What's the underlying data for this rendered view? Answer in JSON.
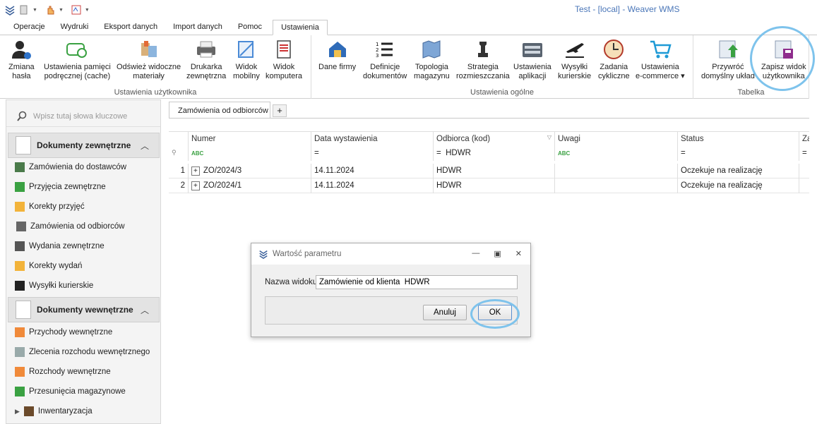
{
  "window": {
    "title": "Test - [local] - Weaver WMS"
  },
  "tabs": [
    "Operacje",
    "Wydruki",
    "Eksport danych",
    "Import danych",
    "Pomoc",
    "Ustawienia"
  ],
  "ribbon": {
    "groups": [
      {
        "label": "Ustawienia użytkownika",
        "buttons": [
          {
            "l1": "Zmiana",
            "l2": "hasła",
            "icon": "user-password-icon"
          },
          {
            "l1": "Ustawienia pamięci",
            "l2": "podręcznej (cache)",
            "icon": "cache-settings-icon"
          },
          {
            "l1": "Odśwież widoczne",
            "l2": "materiały",
            "icon": "refresh-materials-icon"
          },
          {
            "l1": "Drukarka",
            "l2": "zewnętrzna",
            "icon": "printer-icon"
          },
          {
            "l1": "Widok",
            "l2": "mobilny",
            "icon": "mobile-view-icon"
          },
          {
            "l1": "Widok",
            "l2": "komputera",
            "icon": "computer-view-icon"
          }
        ]
      },
      {
        "label": "Ustawienia ogólne",
        "buttons": [
          {
            "l1": "Dane firmy",
            "l2": "",
            "icon": "company-icon"
          },
          {
            "l1": "Definicje",
            "l2": "dokumentów",
            "icon": "document-definitions-icon"
          },
          {
            "l1": "Topologia",
            "l2": "magazynu",
            "icon": "warehouse-map-icon"
          },
          {
            "l1": "Strategia",
            "l2": "rozmieszczania",
            "icon": "chess-icon"
          },
          {
            "l1": "Ustawienia",
            "l2": "aplikacji",
            "icon": "app-settings-icon"
          },
          {
            "l1": "Wysyłki",
            "l2": "kurierskie",
            "icon": "plane-icon"
          },
          {
            "l1": "Zadania",
            "l2": "cykliczne",
            "icon": "clock-icon"
          },
          {
            "l1": "Ustawienia",
            "l2": "e-commerce ▾",
            "icon": "cart-icon"
          }
        ]
      },
      {
        "label": "Tabelka",
        "buttons": [
          {
            "l1": "Przywróć",
            "l2": "domyślny układ",
            "icon": "restore-layout-icon"
          },
          {
            "l1": "Zapisz widok",
            "l2": "użytkownika",
            "icon": "save-view-icon"
          }
        ]
      }
    ]
  },
  "sidebar": {
    "search_placeholder": "Wpisz tutaj słowa kluczowe",
    "group1": {
      "title": "Dokumenty zewnętrzne",
      "items": [
        "Zamówienia do dostawców",
        "Przyjęcia zewnętrzne",
        "Korekty przyjęć",
        "Zamówienia od odbiorców",
        "Wydania zewnętrzne",
        "Korekty wydań",
        "Wysyłki kurierskie"
      ]
    },
    "group2": {
      "title": "Dokumenty wewnętrzne",
      "items": [
        "Przychody wewnętrzne",
        "Zlecenia rozchodu wewnętrznego",
        "Rozchody wewnętrzne",
        "Przesunięcia magazynowe",
        "Inwentaryzacja"
      ]
    }
  },
  "doc": {
    "tab": "Zamówienia od odbiorców",
    "plus": "+",
    "columns": [
      "Numer",
      "Data wystawienia",
      "Odbiorca (kod)",
      "Uwagi",
      "Status",
      "Za"
    ],
    "filter": {
      "odbiorca": "HDWR",
      "eq": "="
    },
    "rows": [
      {
        "n": "1",
        "numer": "ZO/2024/3",
        "data": "14.11.2024",
        "odbiorca": "HDWR",
        "uwagi": "",
        "status": "Oczekuje na realizację"
      },
      {
        "n": "2",
        "numer": "ZO/2024/1",
        "data": "14.11.2024",
        "odbiorca": "HDWR",
        "uwagi": "",
        "status": "Oczekuje na realizację"
      }
    ]
  },
  "dialog": {
    "title": "Wartość parametru",
    "field_label": "Nazwa widoku",
    "field_value": "Zamówienie od klienta  HDWR",
    "cancel": "Anuluj",
    "ok": "OK"
  }
}
